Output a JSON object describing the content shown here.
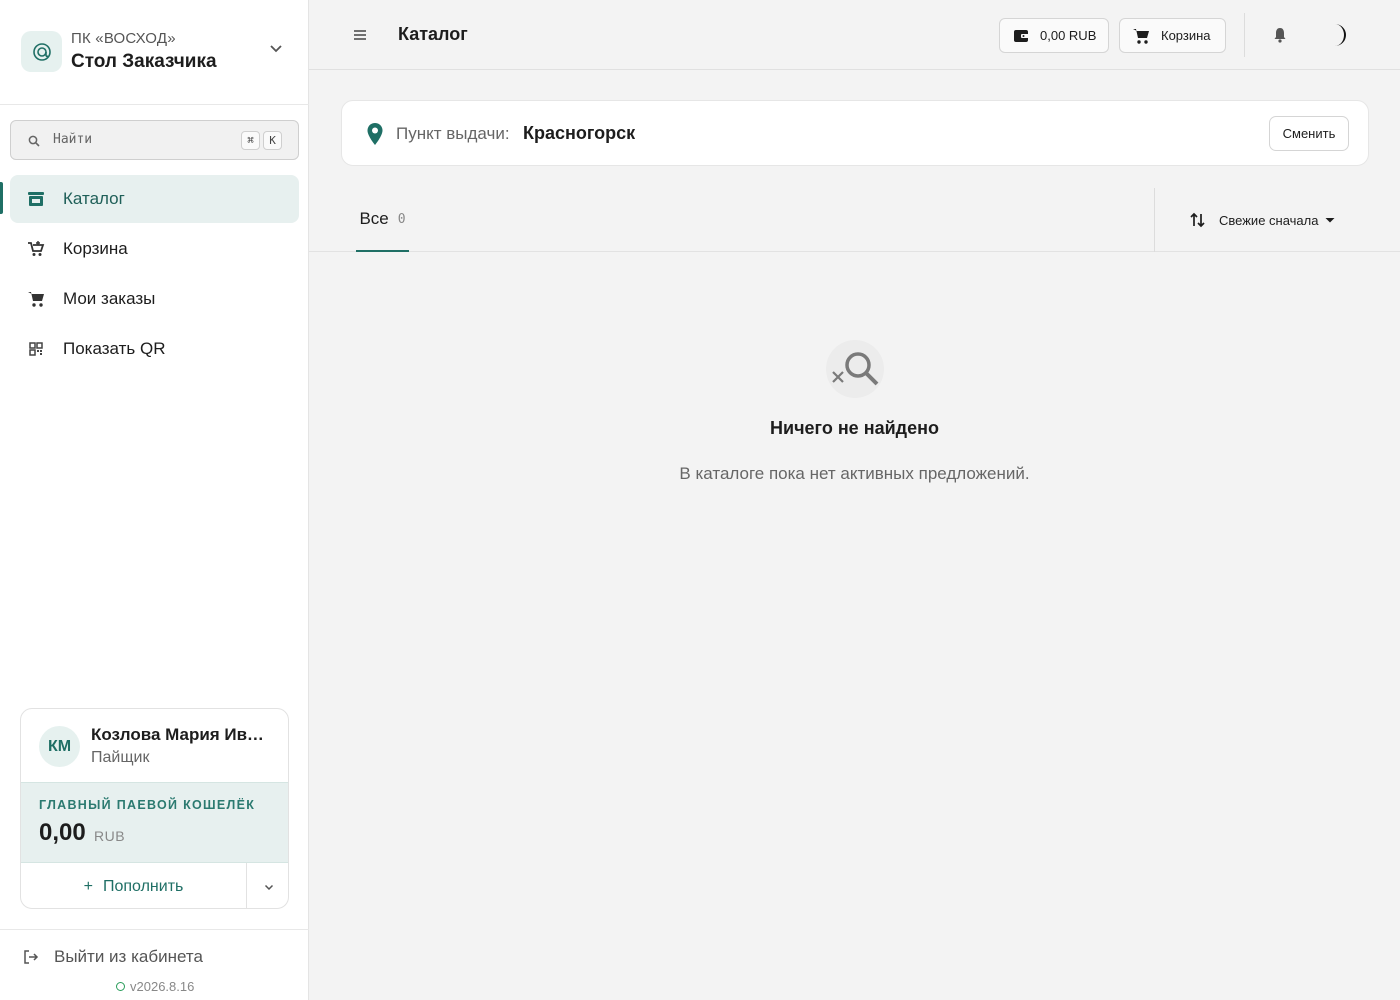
{
  "org": {
    "subtitle": "ПК «ВОСХОД»",
    "name": "Стол Заказчика"
  },
  "search": {
    "placeholder": "Найти",
    "shortcut_mod": "⌘",
    "shortcut_key": "K"
  },
  "nav": {
    "items": [
      {
        "label": "Каталог",
        "icon": "store-icon",
        "active": true
      },
      {
        "label": "Корзина",
        "icon": "cart-add-icon",
        "active": false
      },
      {
        "label": "Мои заказы",
        "icon": "cart-icon",
        "active": false
      },
      {
        "label": "Показать QR",
        "icon": "qr-icon",
        "active": false
      }
    ]
  },
  "user": {
    "initials": "КМ",
    "name": "Козлова Мария Иванова",
    "role": "Пайщик"
  },
  "wallet": {
    "title": "ГЛАВНЫЙ ПАЕВОЙ КОШЕЛЁК",
    "amount": "0,00",
    "currency": "RUB",
    "topup_label": "Пополнить"
  },
  "logout": {
    "label": "Выйти из кабинета"
  },
  "version": "v2026.8.16",
  "header": {
    "title": "Каталог",
    "balance": "0,00 RUB",
    "cart_label": "Корзина"
  },
  "pickup": {
    "label": "Пункт выдачи:",
    "city": "Красногорск",
    "change_label": "Сменить"
  },
  "tabs": [
    {
      "label": "Все",
      "count": "0"
    }
  ],
  "sort": {
    "label": "Свежие сначала"
  },
  "empty": {
    "title": "Ничего не найдено",
    "text": "В каталоге пока нет активных предложений."
  },
  "colors": {
    "accent": "#1f6f65",
    "accent_bg": "#e7f0ef",
    "background": "#f3f3f3"
  }
}
